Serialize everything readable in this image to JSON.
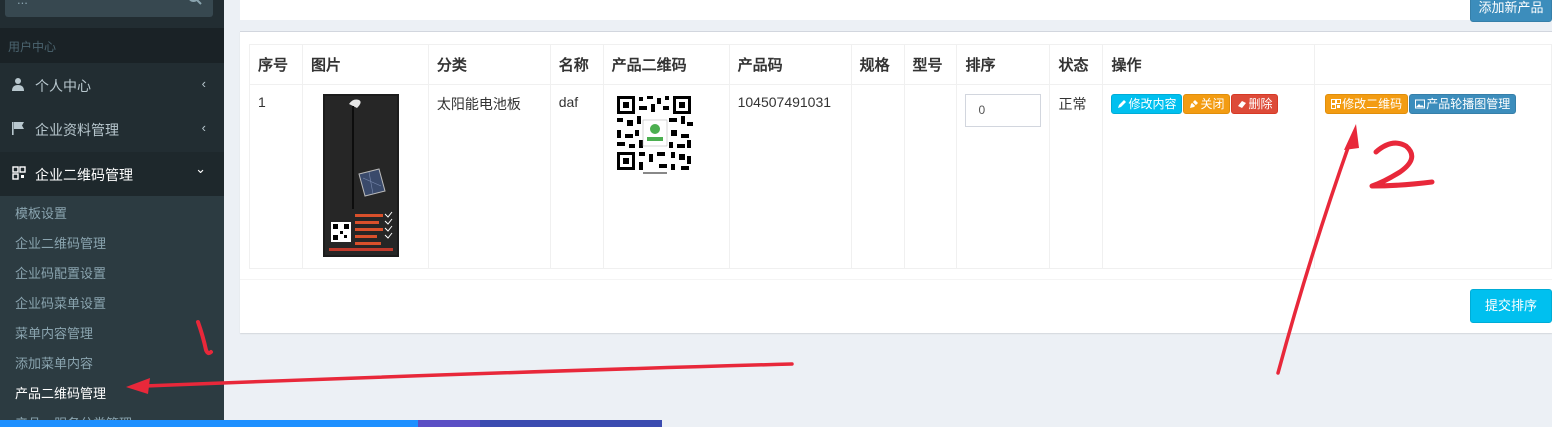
{
  "sidebar": {
    "search_placeholder": "...",
    "header_label": "用户中心",
    "menu": [
      {
        "label": "个人中心",
        "icon": "user-icon",
        "caret": "‹"
      },
      {
        "label": "企业资料管理",
        "icon": "flag-icon",
        "caret": "‹"
      },
      {
        "label": "企业二维码管理",
        "icon": "qrcode-icon",
        "caret": "⌄"
      }
    ],
    "submenu": [
      "模板设置",
      "企业二维码管理",
      "企业码配置设置",
      "企业码菜单设置",
      "菜单内容管理",
      "添加菜单内容",
      "产品二维码管理",
      "产品一服务分类管理"
    ]
  },
  "toolbar": {
    "add_label": "添加新产品"
  },
  "table": {
    "headers": [
      "序号",
      "图片",
      "分类",
      "名称",
      "产品二维码",
      "产品码",
      "规格",
      "型号",
      "排序",
      "状态",
      "操作"
    ],
    "rows": [
      {
        "index": "1",
        "category": "太阳能电池板",
        "name": "daf",
        "product_code": "104507491031",
        "spec": "",
        "model": "",
        "sort_value": "0",
        "status": "正常",
        "actions": [
          "修改内容",
          "关闭",
          "删除"
        ],
        "actions2": [
          "修改二维码",
          "产品轮播图管理"
        ]
      }
    ]
  },
  "footer": {
    "submit_label": "提交排序"
  },
  "annotations": [
    "1",
    "2"
  ],
  "colors": {
    "sidebar_bg": "#222d32",
    "primary": "#3c8dbc",
    "info": "#00c0ef",
    "warning": "#f39c12",
    "danger": "#dd4b39",
    "annotation": "#e8283a"
  }
}
